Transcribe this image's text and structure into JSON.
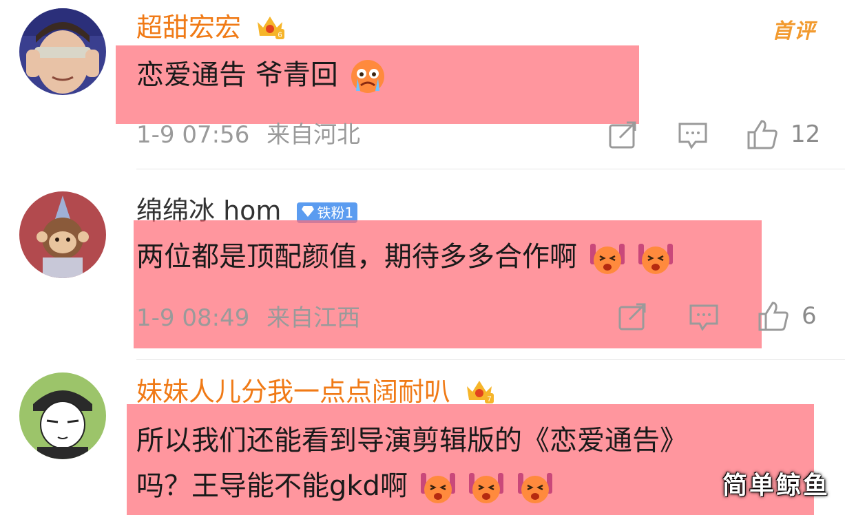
{
  "comments": [
    {
      "username": "超甜宏宏",
      "crown_level": "6",
      "tag": "首评",
      "text": "恋爱通告 爷青回",
      "emoji": "crying-face",
      "time": "1-9 07:56",
      "location": "来自河北",
      "likes": "12"
    },
    {
      "username": "绵绵冰 hom",
      "fan_badge": "铁粉1",
      "text": "两位都是顶配颜值，期待多多合作啊",
      "emoji": "cheering-face",
      "time": "1-9 08:49",
      "location": "来自江西",
      "likes": "6"
    },
    {
      "username": "妹妹人儿分我一点点阔耐叭",
      "crown_level": "7",
      "text_line1": "所以我们还能看到导演剪辑版的《恋爱通告》",
      "text_line2": "吗？王导能不能gkd啊",
      "emoji": "cheering-face"
    }
  ],
  "watermark": "简单鲸鱼",
  "colors": {
    "vip_name": "#f07a16",
    "highlight": "#ff6e78",
    "meta_gray": "#9a9a9a"
  }
}
